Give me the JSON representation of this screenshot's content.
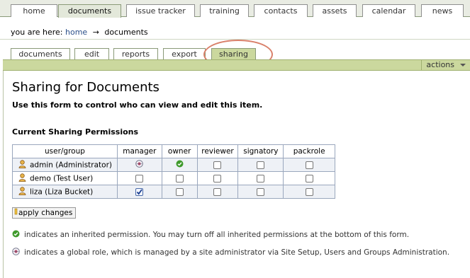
{
  "top_nav": {
    "tabs": [
      {
        "label": "home",
        "active": false
      },
      {
        "label": "documents",
        "active": true
      },
      {
        "label": "issue tracker",
        "active": false
      },
      {
        "label": "training",
        "active": false
      },
      {
        "label": "contacts",
        "active": false
      },
      {
        "label": "assets",
        "active": false
      },
      {
        "label": "calendar",
        "active": false
      },
      {
        "label": "news",
        "active": false
      }
    ]
  },
  "breadcrumb": {
    "prefix": "you are here:",
    "home": "home",
    "separator": "→",
    "current": "documents"
  },
  "content_tabs": [
    {
      "label": "documents",
      "active": false
    },
    {
      "label": "edit",
      "active": false
    },
    {
      "label": "reports",
      "active": false
    },
    {
      "label": "export",
      "active": false
    },
    {
      "label": "sharing",
      "active": true
    }
  ],
  "actions_menu": {
    "label": "actions",
    "icon": "chevron-down-icon"
  },
  "page": {
    "title": "Sharing for Documents",
    "description": "Use this form to control who can view and edit this item.",
    "section_heading": "Current Sharing Permissions"
  },
  "table": {
    "headers": [
      "user/group",
      "manager",
      "owner",
      "reviewer",
      "signatory",
      "packrole"
    ],
    "rows": [
      {
        "user": "admin (Administrator)",
        "cells": [
          "global",
          "inherited",
          "unchecked",
          "unchecked",
          "unchecked"
        ]
      },
      {
        "user": "demo (Test User)",
        "cells": [
          "unchecked",
          "unchecked",
          "unchecked",
          "unchecked",
          "unchecked"
        ]
      },
      {
        "user": "liza (Liza Bucket)",
        "cells": [
          "checked",
          "unchecked",
          "unchecked",
          "unchecked",
          "unchecked"
        ]
      }
    ]
  },
  "apply_button": {
    "label": "apply changes"
  },
  "legend": {
    "inherited": "indicates an inherited permission. You may turn off all inherited permissions at the bottom of this form.",
    "global": "indicates a global role, which is managed by a site administrator via Site Setup, Users and Groups Administration."
  },
  "colors": {
    "accent_green": "#cbd89e",
    "highlight_ring": "#d9806a",
    "link": "#2b4f8a",
    "inherited_check": "#3f9a2c"
  }
}
